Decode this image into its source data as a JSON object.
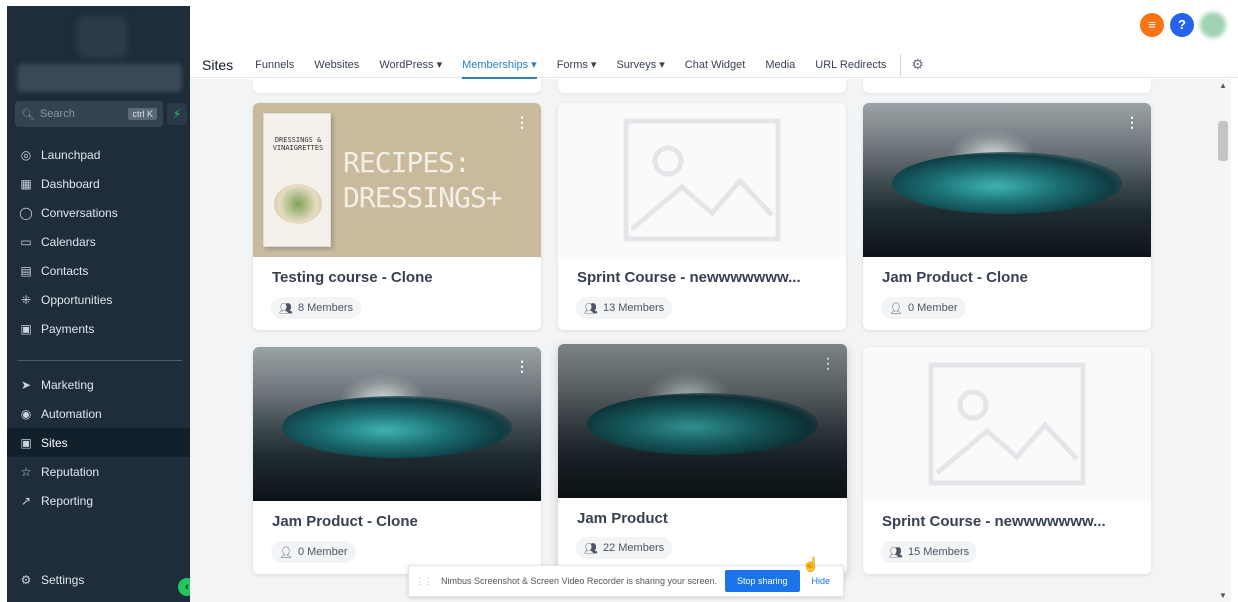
{
  "sidebar": {
    "search_placeholder": "Search",
    "search_shortcut": "ctrl K",
    "nav_top": [
      {
        "label": "Launchpad",
        "icon": "launchpad-icon"
      },
      {
        "label": "Dashboard",
        "icon": "dashboard-icon"
      },
      {
        "label": "Conversations",
        "icon": "chat-icon"
      },
      {
        "label": "Calendars",
        "icon": "calendar-icon"
      },
      {
        "label": "Contacts",
        "icon": "contacts-icon"
      },
      {
        "label": "Opportunities",
        "icon": "opportunities-icon"
      },
      {
        "label": "Payments",
        "icon": "payments-icon"
      }
    ],
    "nav_bottom": [
      {
        "label": "Marketing",
        "icon": "send-icon"
      },
      {
        "label": "Automation",
        "icon": "automation-icon"
      },
      {
        "label": "Sites",
        "icon": "sites-icon",
        "active": true
      },
      {
        "label": "Reputation",
        "icon": "star-icon"
      },
      {
        "label": "Reporting",
        "icon": "trend-icon"
      }
    ],
    "settings_label": "Settings"
  },
  "topbar": {
    "section_title": "Sites",
    "tabs": [
      {
        "label": "Funnels"
      },
      {
        "label": "Websites"
      },
      {
        "label": "WordPress ▾"
      },
      {
        "label": "Memberships ▾",
        "active": true
      },
      {
        "label": "Forms ▾"
      },
      {
        "label": "Surveys ▾"
      },
      {
        "label": "Chat Widget"
      },
      {
        "label": "Media"
      },
      {
        "label": "URL Redirects"
      }
    ]
  },
  "cards": [
    {
      "title": "Testing course - Clone",
      "members": "8 Members",
      "image": "book"
    },
    {
      "title": "Sprint Course - newwwwwww...",
      "members": "13 Members",
      "image": "placeholder"
    },
    {
      "title": "Jam Product - Clone",
      "members": "0 Member",
      "image": "wave"
    },
    {
      "title": "Jam Product - Clone",
      "members": "0 Member",
      "image": "wave"
    },
    {
      "title": "Jam Product",
      "members": "22 Members",
      "image": "wave"
    },
    {
      "title": "Sprint Course - newwwwwww...",
      "members": "15 Members",
      "image": "placeholder"
    }
  ],
  "book_cover": {
    "book_text": "DRESSINGS & VINAIGRETTES",
    "headline_1": "RECIPES:",
    "headline_2": "DRESSINGS+"
  },
  "sharebar": {
    "message": "Nimbus Screenshot & Screen Video Recorder is sharing your screen.",
    "stop_label": "Stop sharing",
    "hide_label": "Hide"
  }
}
